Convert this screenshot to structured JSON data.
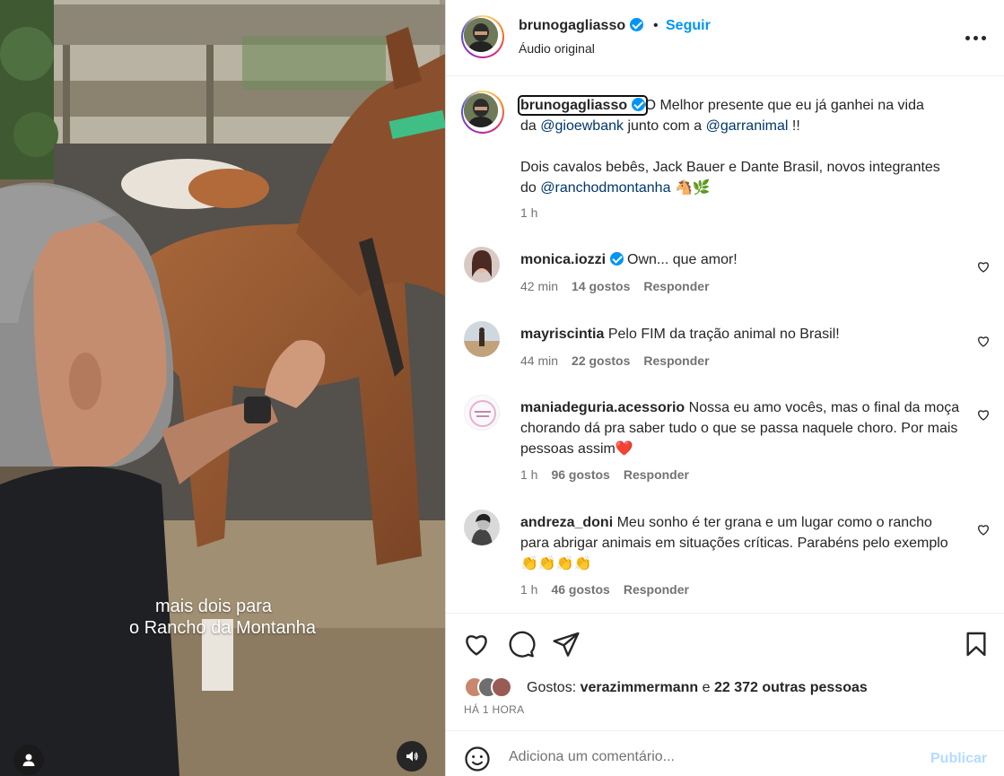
{
  "video": {
    "caption_line1": "mais dois para",
    "caption_line2": "o Rancho da Montanha",
    "user_tag_icon": "user-icon",
    "mute_icon": "speaker-icon"
  },
  "header": {
    "username": "brunogagliasso",
    "dot": "•",
    "follow_label": "Seguir",
    "audio_label": "Áudio original",
    "more_icon": "more-horizontal-icon"
  },
  "caption": {
    "username": "brunogagliasso",
    "line1_text": "O Melhor presente que eu já ganhei na vida",
    "line2_pre": "da ",
    "mention1": "@gioewbank",
    "line2_mid": " junto com a ",
    "mention2": "@garranimal",
    "line2_post": " !!",
    "para2_line1": "Dois cavalos bebês, Jack Bauer e Dante Brasil, novos integrantes",
    "para2_pre": "do ",
    "mention3": "@ranchodmontanha",
    "emojis": "🐴🌿",
    "time": "1 h"
  },
  "comments": [
    {
      "username": "monica.iozzi",
      "verified": true,
      "text": "Own... que amor!",
      "time": "42 min",
      "likes": "14 gostos",
      "reply": "Responder"
    },
    {
      "username": "mayriscintia",
      "verified": false,
      "text": "Pelo FIM da tração animal no Brasil!",
      "time": "44 min",
      "likes": "22 gostos",
      "reply": "Responder"
    },
    {
      "username": "maniadeguria.acessorio",
      "verified": false,
      "text": "Nossa eu amo vocês, mas o final da moça chorando dá pra saber tudo o que se passa naquele choro. Por mais pessoas assim❤️",
      "time": "1 h",
      "likes": "96 gostos",
      "reply": "Responder"
    },
    {
      "username": "andreza_doni",
      "verified": false,
      "text": "Meu sonho é ter grana e um lugar como o rancho para abrigar animais em situações críticas. Parabéns pelo exemplo 👏👏👏👏",
      "time": "1 h",
      "likes": "46 gostos",
      "reply": "Responder"
    }
  ],
  "actions": {
    "like_icon": "heart-icon",
    "comment_icon": "comment-bubble-icon",
    "share_icon": "paper-plane-icon",
    "save_icon": "bookmark-icon"
  },
  "likes": {
    "prefix": "Gostos: ",
    "user": "verazimmermann",
    "joiner": " e ",
    "others": "22 372 outras pessoas"
  },
  "time_ago": "HÁ 1 HORA",
  "comment_box": {
    "placeholder": "Adiciona um comentário...",
    "publish_label": "Publicar"
  },
  "colors": {
    "accent": "#0095f6",
    "mention": "#00376b",
    "muted": "#737373",
    "publish_disabled": "#b3dbff",
    "heart_red": "#e0245e"
  }
}
